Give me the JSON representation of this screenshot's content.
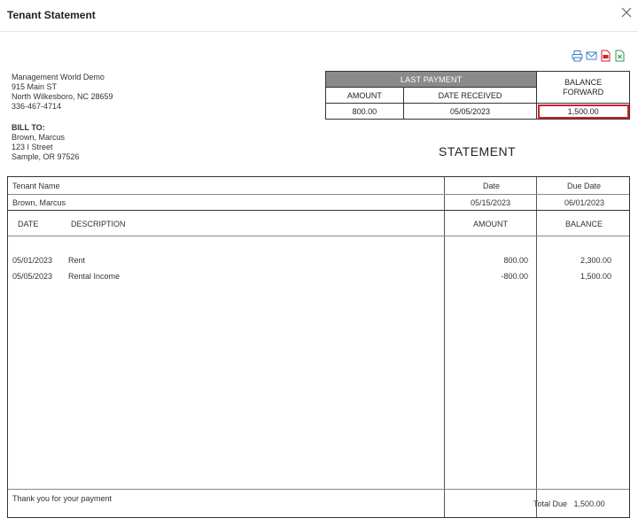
{
  "window": {
    "title": "Tenant Statement",
    "close_icon": "close-icon"
  },
  "toolbar": {
    "icons": [
      "print-icon",
      "email-icon",
      "pdf-icon",
      "excel-icon"
    ]
  },
  "company": {
    "name": "Management World Demo",
    "street": "915 Main ST",
    "city": "North Wilkesboro, NC 28659",
    "phone": "336-467-4714"
  },
  "bill_to": {
    "label": "BILL TO:",
    "name": "Brown, Marcus",
    "street": "123 I Street",
    "city": "Sample, OR 97526"
  },
  "last_payment": {
    "header": "LAST PAYMENT",
    "amount_label": "AMOUNT",
    "date_label": "DATE RECEIVED",
    "amount": "800.00",
    "date": "05/05/2023"
  },
  "balance_forward": {
    "label_line1": "BALANCE",
    "label_line2": "FORWARD",
    "value": "1,500.00",
    "highlight_color": "#d0202a"
  },
  "statement": {
    "title": "STATEMENT",
    "tenant_name_label": "Tenant Name",
    "date_label": "Date",
    "due_date_label": "Due Date",
    "tenant_name": "Brown, Marcus",
    "date": "05/15/2023",
    "due_date": "06/01/2023",
    "columns": {
      "date": "DATE",
      "description": "DESCRIPTION",
      "amount": "AMOUNT",
      "balance": "BALANCE"
    },
    "rows": [
      {
        "date": "05/01/2023",
        "description": "Rent",
        "amount": "800.00",
        "balance": "2,300.00"
      },
      {
        "date": "05/05/2023",
        "description": "Rental Income",
        "amount": "-800.00",
        "balance": "1,500.00"
      }
    ],
    "footer_message": "Thank you for your payment",
    "total_due_label": "Total Due",
    "total_due": "1,500.00"
  }
}
